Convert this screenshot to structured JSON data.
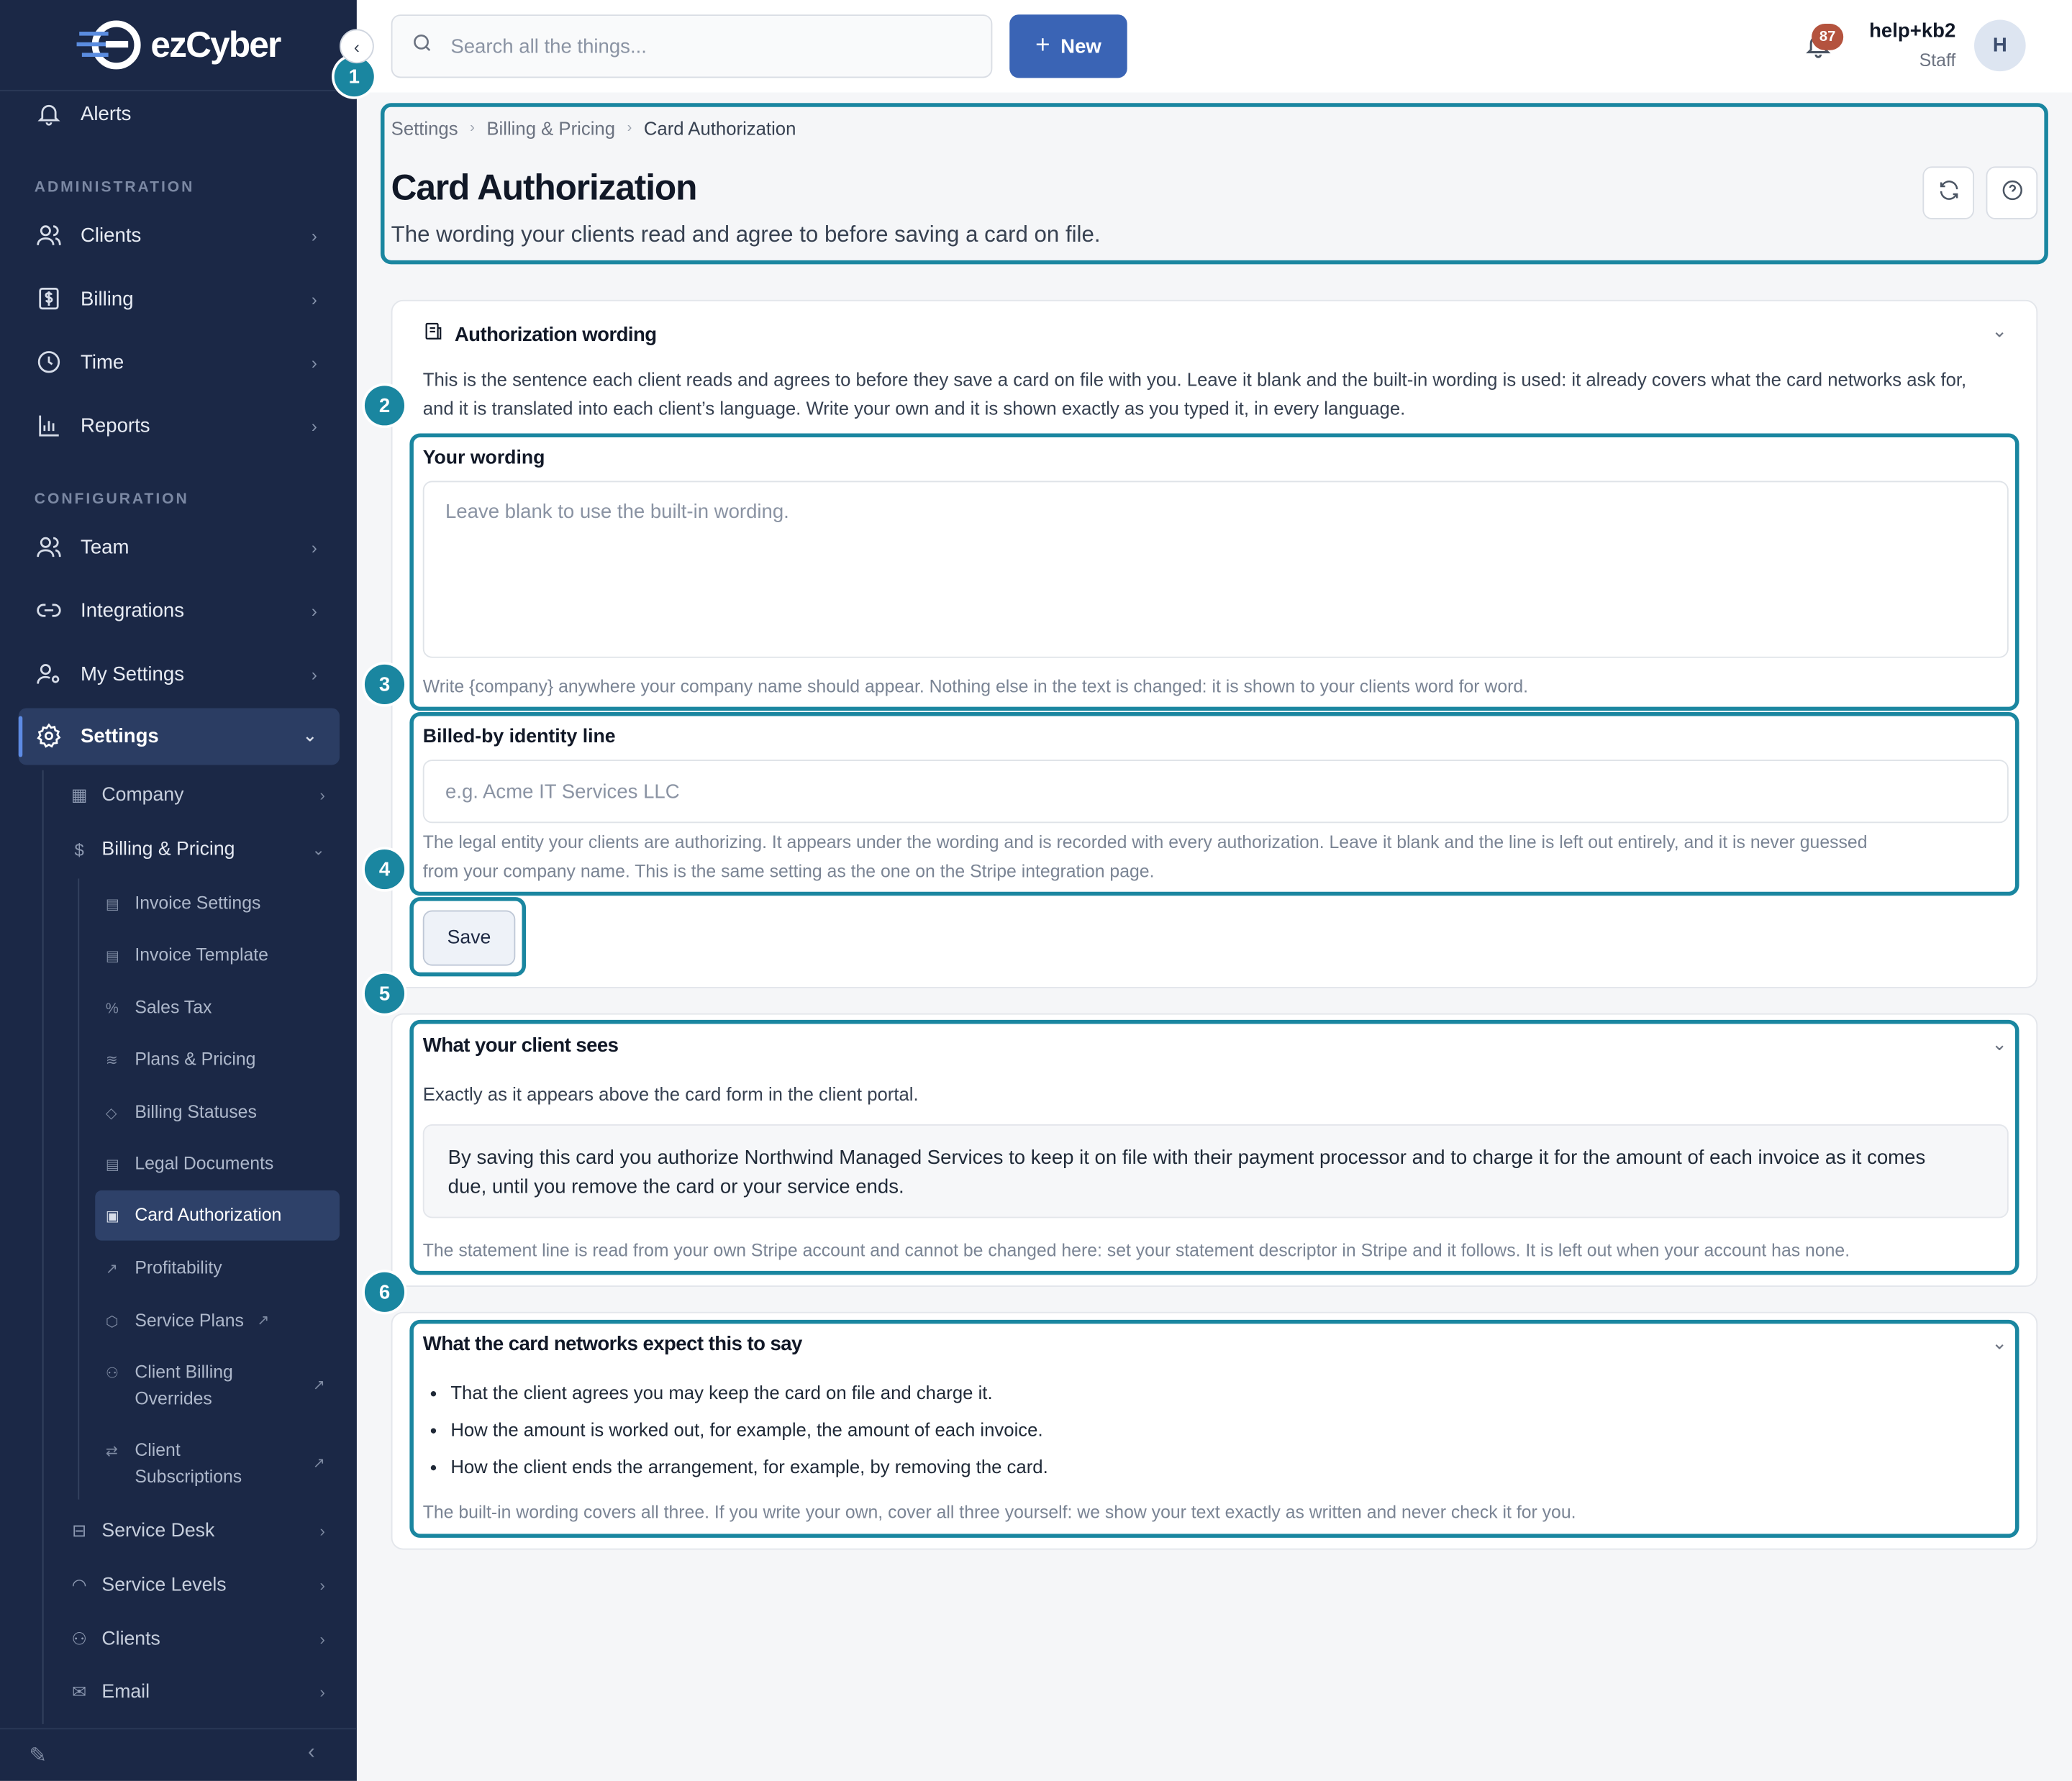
{
  "app": {
    "logo_prefix": "ez",
    "logo_suffix": "Cyber"
  },
  "sidebar": {
    "alerts": "Alerts",
    "sections": {
      "administration": "ADMINISTRATION",
      "configuration": "CONFIGURATION"
    },
    "admin_items": [
      "Clients",
      "Billing",
      "Time",
      "Reports"
    ],
    "config_items": [
      "Team",
      "Integrations",
      "My Settings",
      "Settings"
    ],
    "settings_children": [
      "Company",
      "Billing & Pricing",
      "Service Desk",
      "Service Levels",
      "Clients",
      "Email"
    ],
    "billing_children": [
      {
        "label": "Invoice Settings",
        "icon": "document-icon"
      },
      {
        "label": "Invoice Template",
        "icon": "document-icon"
      },
      {
        "label": "Sales Tax",
        "icon": "percent-icon"
      },
      {
        "label": "Plans & Pricing",
        "icon": "layers-icon"
      },
      {
        "label": "Billing Statuses",
        "icon": "tag-icon"
      },
      {
        "label": "Legal Documents",
        "icon": "document-icon"
      },
      {
        "label": "Card Authorization",
        "icon": "receipt-icon"
      },
      {
        "label": "Profitability",
        "icon": "trend-icon"
      },
      {
        "label": "Service Plans",
        "icon": "box-icon"
      },
      {
        "label": "Client Billing Overrides",
        "icon": "users-icon"
      },
      {
        "label": "Client Subscriptions",
        "icon": "repeat-icon"
      }
    ]
  },
  "topbar": {
    "search_placeholder": "Search all the things...",
    "new_label": "New",
    "notification_count": "87",
    "user_name": "help+kb2",
    "user_role": "Staff",
    "avatar_initial": "H"
  },
  "breadcrumb": [
    "Settings",
    "Billing & Pricing",
    "Card Authorization"
  ],
  "page": {
    "title": "Card Authorization",
    "subtitle": "The wording your clients read and agree to before saving a card on file."
  },
  "wording_card": {
    "title": "Authorization wording",
    "intro_line1": "This is the sentence each client reads and agrees to before they save a card on file with you. Leave it blank and the built-in wording is used: it already covers what the card networks ask for,",
    "intro_line2": "and it is translated into each client’s language. Write your own and it is shown exactly as you typed it, in every language.",
    "wording_label": "Your wording",
    "wording_value": "",
    "wording_placeholder": "Leave blank to use the built-in wording.",
    "wording_hint": "Write {company} anywhere your company name should appear. Nothing else in the text is changed: it is shown to your clients word for word.",
    "billed_label": "Billed-by identity line",
    "billed_value": "",
    "billed_placeholder": "e.g. Acme IT Services LLC",
    "billed_hint_line1": "The legal entity your clients are authorizing. It appears under the wording and is recorded with every authorization. Leave it blank and the line is left out entirely, and it is never guessed",
    "billed_hint_line2": "from your company name. This is the same setting as the one on the Stripe integration page.",
    "save_label": "Save"
  },
  "client_sees_card": {
    "title": "What your client sees",
    "intro": "Exactly as it appears above the card form in the client portal.",
    "preview_line1": "By saving this card you authorize Northwind Managed Services to keep it on file with their payment processor and to charge it for the amount of each invoice as it comes",
    "preview_line2": "due, until you remove the card or your service ends.",
    "footnote": "The statement line is read from your own Stripe account and cannot be changed here: set your statement descriptor in Stripe and it follows. It is left out when your account has none."
  },
  "networks_card": {
    "title": "What the card networks expect this to say",
    "bullets": [
      "That the client agrees you may keep the card on file and charge it.",
      "How the amount is worked out, for example, the amount of each invoice.",
      "How the client ends the arrangement, for example, by removing the card."
    ],
    "footnote": "The built-in wording covers all three. If you write your own, cover all three yourself: we show your text exactly as written and never check it for you."
  },
  "annotations": [
    "1",
    "2",
    "3",
    "4",
    "5",
    "6"
  ],
  "colors": {
    "sidebar_bg": "#1b2846",
    "accent": "#3a64b5",
    "annotation": "#1a86a0",
    "badge": "#b4533e"
  }
}
